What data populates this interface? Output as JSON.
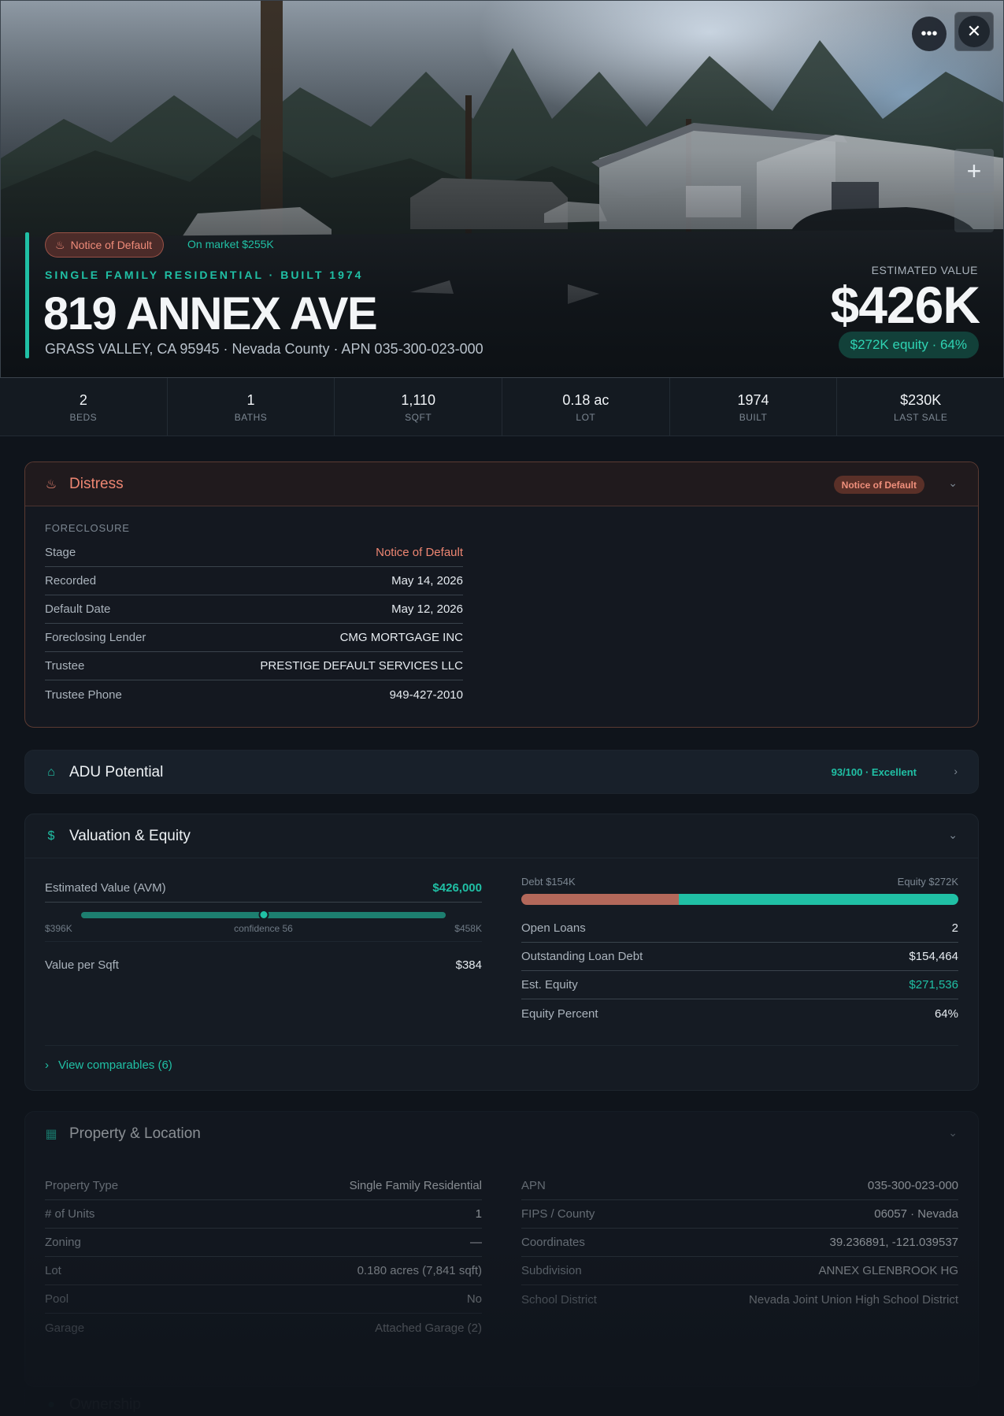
{
  "hero": {
    "distress_chip": "Notice of Default",
    "on_market": "On market $255K",
    "eyebrow": "SINGLE FAMILY RESIDENTIAL · BUILT 1974",
    "address": "819 ANNEX AVE",
    "sub_address": "GRASS VALLEY, CA 95945 · Nevada County · APN 035-300-023-000",
    "estimated_label": "ESTIMATED VALUE",
    "estimated_value": "$426K",
    "equity_pill": "$272K equity · 64%"
  },
  "stats": [
    {
      "value": "2",
      "label": "BEDS"
    },
    {
      "value": "1",
      "label": "BATHS"
    },
    {
      "value": "1,110",
      "label": "SQFT"
    },
    {
      "value": "0.18 ac",
      "label": "LOT"
    },
    {
      "value": "1974",
      "label": "BUILT"
    },
    {
      "value": "$230K",
      "label": "LAST SALE"
    }
  ],
  "distress": {
    "title": "Distress",
    "badge": "Notice of Default",
    "section": "FORECLOSURE",
    "rows": [
      {
        "k": "Stage",
        "v": "Notice of Default"
      },
      {
        "k": "Recorded",
        "v": "May 14, 2026"
      },
      {
        "k": "Default Date",
        "v": "May 12, 2026"
      },
      {
        "k": "Foreclosing Lender",
        "v": "CMG MORTGAGE INC"
      },
      {
        "k": "Trustee",
        "v": "PRESTIGE DEFAULT SERVICES LLC"
      },
      {
        "k": "Trustee Phone",
        "v": "949-427-2010"
      }
    ]
  },
  "adu": {
    "title": "ADU Potential",
    "score": "93/100 · Excellent"
  },
  "valuation": {
    "title": "Valuation & Equity",
    "avm_label": "Estimated Value (AVM)",
    "avm_value": "$426,000",
    "range_low": "$396K",
    "confidence": "confidence 56",
    "range_high": "$458K",
    "avm_position": 0.5,
    "ppsf_label": "Value per Sqft",
    "ppsf_value": "$384",
    "debt_label": "Debt $154K",
    "equity_label": "Equity $272K",
    "debt_fraction": 0.36,
    "rows": [
      {
        "k": "Open Loans",
        "v": "2"
      },
      {
        "k": "Outstanding Loan Debt",
        "v": "$154,464"
      },
      {
        "k": "Est. Equity",
        "v": "$271,536"
      },
      {
        "k": "Equity Percent",
        "v": "64%"
      }
    ],
    "comparables": "View comparables (6)"
  },
  "property": {
    "title": "Property & Location",
    "left": [
      {
        "k": "Property Type",
        "v": "Single Family Residential"
      },
      {
        "k": "# of Units",
        "v": "1"
      },
      {
        "k": "Zoning",
        "v": "—"
      },
      {
        "k": "Lot",
        "v": "0.180 acres (7,841 sqft)"
      },
      {
        "k": "Pool",
        "v": "No"
      },
      {
        "k": "Garage",
        "v": "Attached Garage (2)"
      }
    ],
    "right": [
      {
        "k": "APN",
        "v": "035-300-023-000"
      },
      {
        "k": "FIPS / County",
        "v": "06057 · Nevada"
      },
      {
        "k": "Coordinates",
        "v": "39.236891, -121.039537"
      },
      {
        "k": "Subdivision",
        "v": "ANNEX GLENBROOK HG"
      },
      {
        "k": "School District",
        "v": "Nevada Joint Union High School District"
      }
    ]
  },
  "ownership": {
    "title": "Ownership"
  },
  "colors": {
    "accent": "#20c0a5",
    "distress": "#ee8672",
    "debt": "#b3685a"
  }
}
